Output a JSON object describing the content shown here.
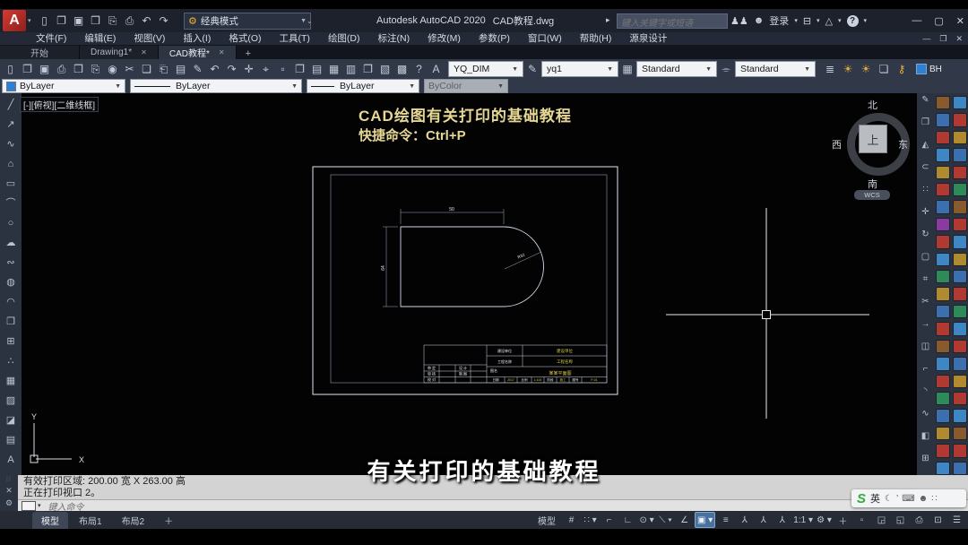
{
  "titlebar": {
    "logo_letter": "A",
    "quick_icons": [
      "▯",
      "❐",
      "▣",
      "❒",
      "⎘",
      "⎙",
      "↶",
      "↷"
    ],
    "classic_mode": "经典模式",
    "app_title": "Autodesk AutoCAD 2020",
    "doc_title": "CAD教程.dwg",
    "search_placeholder": "键入关键字或短语",
    "signin": "登录",
    "window_controls": [
      "—",
      "▢",
      "✕"
    ]
  },
  "menubar": {
    "items": [
      "文件(F)",
      "编辑(E)",
      "视图(V)",
      "插入(I)",
      "格式(O)",
      "工具(T)",
      "绘图(D)",
      "标注(N)",
      "修改(M)",
      "参数(P)",
      "窗口(W)",
      "帮助(H)",
      "源泉设计"
    ],
    "win_controls": [
      "—",
      "❐",
      "✕"
    ]
  },
  "filetabs": {
    "start": "开始",
    "doc1": "Drawing1*",
    "doc2": "CAD教程*",
    "close": "✕",
    "plus": "+"
  },
  "toolbar": {
    "icons": [
      "▯",
      "❐",
      "▣",
      "⎙",
      "❒",
      "⎘",
      "◉",
      "✂",
      "❏",
      "⎗",
      "▤",
      "✎",
      "↶",
      "↷",
      "✛",
      "⌖",
      "▫",
      "❐",
      "▤",
      "▦",
      "▥",
      "❒",
      "▧",
      "▩",
      "?",
      "A"
    ],
    "dim_style": "YQ_DIM",
    "text_style": "yq1",
    "table_style": "Standard",
    "mleader_style": "Standard",
    "end_icons": [
      "≣"
    ],
    "bulb1": "☀",
    "bulb2": "☀",
    "box_icon": "❏",
    "lock_icon": "⚷",
    "bh_label": "BH"
  },
  "properties": {
    "color": "ByLayer",
    "linetype": "ByLayer",
    "lineweight": "ByLayer",
    "plotstyle": "ByColor",
    "swatch_color": "#2f7fd4"
  },
  "left_toolbar": {
    "icons": [
      "╱",
      "↗",
      "∿",
      "⌂",
      "▭",
      "⌒",
      "○",
      "☁",
      "∾",
      "◍",
      "◠",
      "❐",
      "⊞",
      "∴",
      "▦",
      "▨",
      "◪",
      "▤",
      "A"
    ]
  },
  "right_toolbar": {
    "col1_icons": [
      "✎",
      "❐",
      "◭",
      "⊂",
      "∷",
      "✛",
      "↻",
      "▢",
      "⌗",
      "✂",
      "→",
      "◫",
      "⌐",
      "◝",
      "∿",
      "◧",
      "⊞"
    ],
    "col2_colors": [
      "#8a5a2f",
      "#3b6fae",
      "#b03a32",
      "#3f87c4",
      "#b08a2f",
      "#b03a32",
      "#3b6fae",
      "#8a3ba0",
      "#b03a32",
      "#3f87c4",
      "#2f8a5a",
      "#b08a2f",
      "#3b6fae",
      "#b03a32",
      "#8a5a2f",
      "#3f87c4",
      "#b03a32",
      "#2f8a5a",
      "#3b6fae",
      "#b08a2f",
      "#b03a32",
      "#3f87c4"
    ],
    "col3_colors": [
      "#3f87c4",
      "#b03a32",
      "#b08a2f",
      "#3b6fae",
      "#b03a32",
      "#2f8a5a",
      "#8a5a2f",
      "#b03a32",
      "#3f87c4",
      "#b08a2f",
      "#3b6fae",
      "#b03a32",
      "#2f8a5a",
      "#3f87c4",
      "#b03a32",
      "#3b6fae",
      "#b08a2f",
      "#b03a32",
      "#3f87c4",
      "#8a5a2f",
      "#b03a32",
      "#3b6fae"
    ]
  },
  "viewport": {
    "label": "[-][俯视][二维线框]"
  },
  "viewcube": {
    "n": "北",
    "s": "南",
    "w": "西",
    "e": "东",
    "top": "上",
    "wcs": "WCS"
  },
  "canvas": {
    "heading1": "CAD绘图有关打印的基础教程",
    "heading2": "快捷命令：Ctrl+P",
    "heading_color": "#e6d795",
    "dim_top": "50",
    "dim_left": "64",
    "dim_radius": "R32"
  },
  "titleblock": {
    "r1_label": "建设单位",
    "r1_value": "建设单位",
    "r2_label": "工程名称",
    "r2_value": "工程名称",
    "tn_label": "图名",
    "tn_value": "某某平面图",
    "c1": [
      "审 定",
      "审 核",
      "校 对"
    ],
    "c2": [
      "设 计",
      "制 图",
      ""
    ],
    "b1_label": "日期",
    "b1_value": "2017",
    "b2_label": "比例",
    "b2_value": "1:100",
    "b3_label": "阶段",
    "b3_value": "施工",
    "b4_label": "图号",
    "b4_value": "P-01"
  },
  "subtitle": "有关打印的基础教程",
  "command": {
    "line1": "有效打印区域:  200.00 宽 X 263.00 高",
    "line2": "正在打印视口 2。",
    "placeholder": "键入命令",
    "close_icon": "✕",
    "wrench_icon": "⚙"
  },
  "layouttabs": {
    "model": "模型",
    "l1": "布局1",
    "l2": "布局2",
    "plus": "＋"
  },
  "statusbar": {
    "model": "模型",
    "icons_a": [
      "#",
      "∷ ▾",
      "⌐",
      "∟",
      "⊙ ▾",
      "⟍ ▾",
      "∠"
    ],
    "osnap": "▣ ▾",
    "icons_b": [
      "≡",
      "⅄",
      "⅄",
      "⅄",
      "1:1 ▾",
      "⚙ ▾",
      "＋",
      "▫"
    ],
    "icons_c": [
      "◲",
      "◱",
      "⎙",
      "⊡",
      "☰"
    ]
  },
  "ime": {
    "logo": "S",
    "mode": "英",
    "icons": [
      "☾",
      "’",
      "⌨",
      "☻",
      "∷"
    ]
  }
}
